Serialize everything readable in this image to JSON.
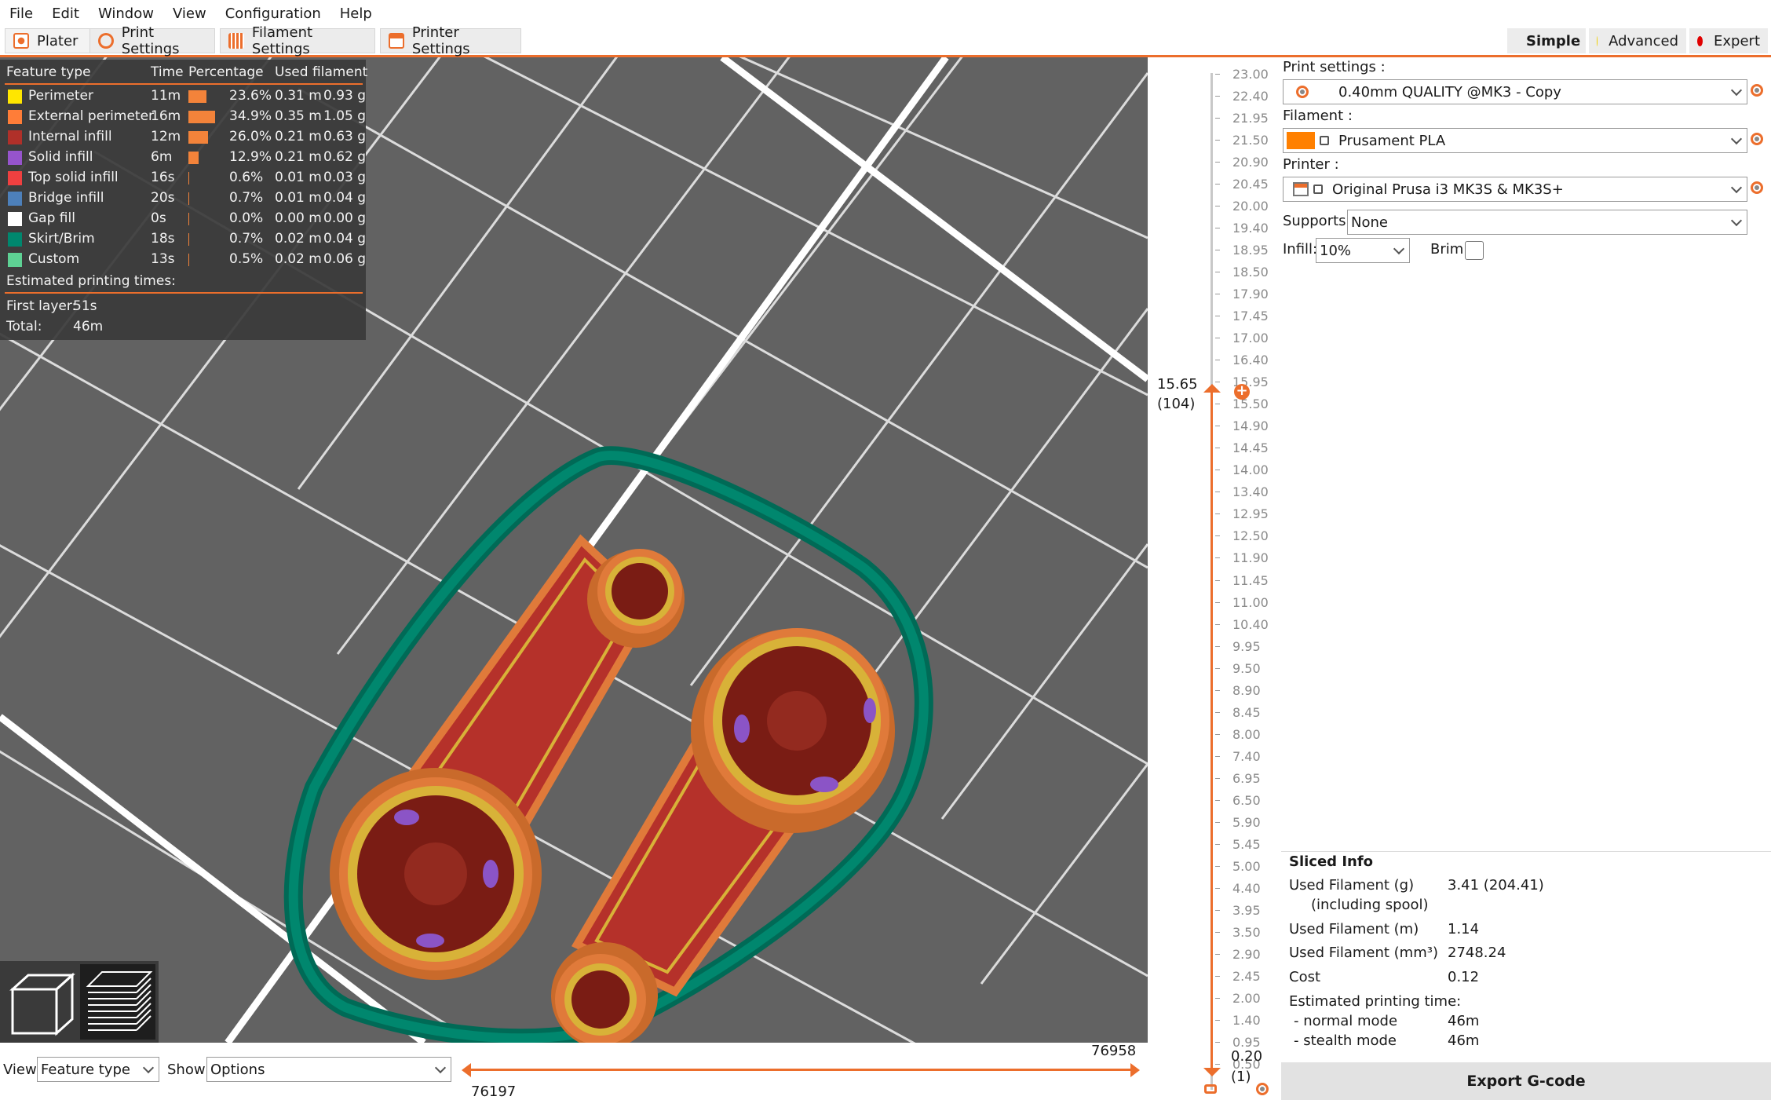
{
  "menu": [
    "File",
    "Edit",
    "Window",
    "View",
    "Configuration",
    "Help"
  ],
  "tabs": [
    {
      "label": "Plater"
    },
    {
      "label": "Print Settings"
    },
    {
      "label": "Filament Settings"
    },
    {
      "label": "Printer Settings"
    }
  ],
  "modes": [
    {
      "label": "Simple",
      "color": "#3ec11b"
    },
    {
      "label": "Advanced",
      "color": "#f0d000"
    },
    {
      "label": "Expert",
      "color": "#e00000"
    }
  ],
  "legend": {
    "headers": {
      "feature": "Feature type",
      "time": "Time",
      "percentage": "Percentage",
      "used": "Used filament"
    },
    "rows": [
      {
        "name": "Perimeter",
        "color": "#ffe600",
        "time": "11m",
        "pct": "23.6%",
        "pct_value": 23.6,
        "m": "0.31 m",
        "g": "0.93 g"
      },
      {
        "name": "External perimeter",
        "color": "#ff7d38",
        "time": "16m",
        "pct": "34.9%",
        "pct_value": 34.9,
        "m": "0.35 m",
        "g": "1.05 g"
      },
      {
        "name": "Internal infill",
        "color": "#b03029",
        "time": "12m",
        "pct": "26.0%",
        "pct_value": 26.0,
        "m": "0.21 m",
        "g": "0.63 g"
      },
      {
        "name": "Solid infill",
        "color": "#9654cc",
        "time": "6m",
        "pct": "12.9%",
        "pct_value": 12.9,
        "m": "0.21 m",
        "g": "0.62 g"
      },
      {
        "name": "Top solid infill",
        "color": "#f04040",
        "time": "16s",
        "pct": "0.6%",
        "pct_value": 0.6,
        "m": "0.01 m",
        "g": "0.03 g"
      },
      {
        "name": "Bridge infill",
        "color": "#4d80ba",
        "time": "20s",
        "pct": "0.7%",
        "pct_value": 0.7,
        "m": "0.01 m",
        "g": "0.04 g"
      },
      {
        "name": "Gap fill",
        "color": "#ffffff",
        "time": "0s",
        "pct": "0.0%",
        "pct_value": 0.0,
        "m": "0.00 m",
        "g": "0.00 g"
      },
      {
        "name": "Skirt/Brim",
        "color": "#00876e",
        "time": "18s",
        "pct": "0.7%",
        "pct_value": 0.7,
        "m": "0.02 m",
        "g": "0.04 g"
      },
      {
        "name": "Custom",
        "color": "#5ed194",
        "time": "13s",
        "pct": "0.5%",
        "pct_value": 0.5,
        "m": "0.02 m",
        "g": "0.06 g"
      }
    ],
    "estimated_title": "Estimated printing times:",
    "first_layer_label": "First layer:",
    "first_layer_value": "51s",
    "total_label": "Total:",
    "total_value": "46m"
  },
  "bottom": {
    "view_label": "View",
    "view_value": "Feature type",
    "show_label": "Show",
    "show_value": "Options",
    "h_slider_min": "76197",
    "h_slider_max": "76958"
  },
  "vslider": {
    "ticks": [
      "23.00",
      "22.40",
      "21.95",
      "21.50",
      "20.90",
      "20.45",
      "20.00",
      "19.40",
      "18.95",
      "18.50",
      "17.90",
      "17.45",
      "17.00",
      "16.40",
      "15.95",
      "15.50",
      "14.90",
      "14.45",
      "14.00",
      "13.40",
      "12.95",
      "12.50",
      "11.90",
      "11.45",
      "11.00",
      "10.40",
      "9.95",
      "9.50",
      "8.90",
      "8.45",
      "8.00",
      "7.40",
      "6.95",
      "6.50",
      "5.90",
      "5.45",
      "5.00",
      "4.40",
      "3.95",
      "3.50",
      "2.90",
      "2.45",
      "2.00",
      "1.40",
      "0.95",
      "0.50"
    ],
    "current_value": "15.65",
    "current_layer": "(104)",
    "bottom_value": "0.20",
    "bottom_layer": "(1)"
  },
  "panel": {
    "print_settings_label": "Print settings :",
    "print_settings_value": "0.40mm QUALITY @MK3 - Copy",
    "filament_label": "Filament :",
    "filament_value": "Prusament PLA",
    "filament_color": "#ff8000",
    "printer_label": "Printer :",
    "printer_value": "Original Prusa i3 MK3S & MK3S+",
    "supports_label": "Supports:",
    "supports_value": "None",
    "infill_label": "Infill:",
    "infill_value": "10%",
    "brim_label": "Brim:"
  },
  "sliced": {
    "title": "Sliced Info",
    "rows": [
      {
        "label": "Used Filament (g)",
        "value": "3.41 (204.41)"
      },
      {
        "label": "(including spool)",
        "value": ""
      },
      {
        "label": "Used Filament (m)",
        "value": "1.14"
      },
      {
        "label": "Used Filament (mm³)",
        "value": "2748.24"
      },
      {
        "label": "Cost",
        "value": "0.12"
      },
      {
        "label": "Estimated printing time:",
        "value": ""
      },
      {
        "label": "- normal mode",
        "value": "46m"
      },
      {
        "label": "- stealth mode",
        "value": "46m"
      }
    ],
    "export_label": "Export G-code"
  }
}
